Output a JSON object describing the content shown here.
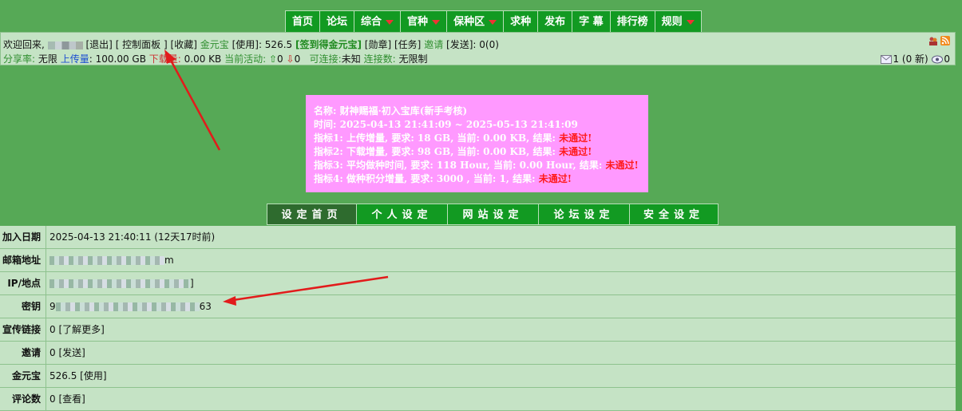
{
  "nav": {
    "items": [
      {
        "label": "首页",
        "dropdown": false
      },
      {
        "label": "论坛",
        "dropdown": false
      },
      {
        "label": "综合",
        "dropdown": true
      },
      {
        "label": "官种",
        "dropdown": true
      },
      {
        "label": "保种区",
        "dropdown": true
      },
      {
        "label": "求种",
        "dropdown": false
      },
      {
        "label": "发布",
        "dropdown": false
      },
      {
        "label": "字 幕",
        "dropdown": false
      },
      {
        "label": "排行榜",
        "dropdown": false
      },
      {
        "label": "规则",
        "dropdown": true
      }
    ]
  },
  "infobar": {
    "welcome": "欢迎回来,",
    "logout": "[退出]",
    "control_panel": "[ 控制面板 ]",
    "favorites": "[收藏]",
    "gold_label": "金元宝",
    "use": "[使用]",
    "gold_value": "526.5",
    "checkin": "[签到得金元宝]",
    "medal": "[勋章]",
    "task": "[任务]",
    "invite_label": "邀请",
    "send": "[发送]",
    "invite_value": "0(0)",
    "ratio_label": "分享率:",
    "ratio_value": "无限",
    "upload_label": "上传量",
    "upload_value": "100.00 GB",
    "download_label": "下载量:",
    "download_value": "0.00 KB",
    "active_label": "当前活动:",
    "active_up": "0",
    "active_down": "0",
    "connectable_label": "可连接:",
    "connectable_value": "未知",
    "connections_label": "连接数:",
    "connections_value": "无限制",
    "messages": "1 (0 新)",
    "watch": "0"
  },
  "notice": {
    "name": "名称: 财神赐福·初入宝库(新手考核)",
    "time": "时间: 2025-04-13 21:41:09 ~ 2025-05-13 21:41:09",
    "items": [
      {
        "text": "指标1: 上传增量, 要求: 18 GB, 当前: 0.00 KB, 结果: ",
        "result": "未通过!"
      },
      {
        "text": "指标2: 下载增量, 要求: 98 GB, 当前: 0.00 KB, 结果: ",
        "result": "未通过!"
      },
      {
        "text": "指标3: 平均做种时间, 要求: 118 Hour, 当前: 0.00 Hour, 结果: ",
        "result": "未通过!"
      },
      {
        "text": "指标4: 做种积分增量, 要求: 3000 , 当前: 1, 结果: ",
        "result": "未通过!"
      }
    ]
  },
  "tabs": [
    "设定首页",
    "个人设定",
    "网站设定",
    "论坛设定",
    "安全设定"
  ],
  "details": [
    {
      "label": "加入日期",
      "value": "2025-04-13 21:40:11 (12天17时前)"
    },
    {
      "label": "邮箱地址",
      "value": "m"
    },
    {
      "label": "IP/地点",
      "value": "]"
    },
    {
      "label": "密钥",
      "prefix": "9",
      "value": "63"
    },
    {
      "label": "宣传链接",
      "value": "0 [了解更多]"
    },
    {
      "label": "邀请",
      "value": "0 [发送]"
    },
    {
      "label": "金元宝",
      "value": "526.5 [使用]"
    },
    {
      "label": "评论数",
      "value": "0 [查看]"
    }
  ],
  "colors": {
    "nav_bg": "#129a22",
    "page_bg": "#56a956",
    "panel_bg": "#c5e3c5",
    "notice_bg": "#ff99ff",
    "fail": "#ff1a1a",
    "arrow": "#e21b1b"
  }
}
